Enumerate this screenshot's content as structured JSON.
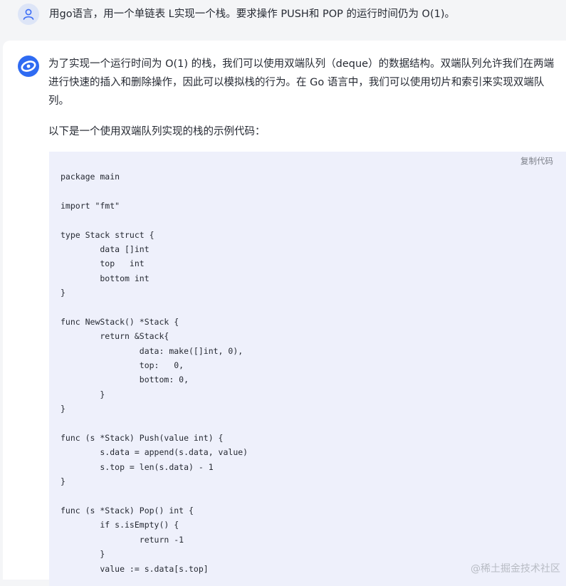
{
  "user_message": {
    "avatar_icon": "user-icon",
    "text": "用go语言，用一个单链表 L实现一个栈。要求操作 PUSH和 POP 的运行时间仍为 O(1)。"
  },
  "assistant_message": {
    "avatar_icon": "assistant-logo-icon",
    "paragraph": "为了实现一个运行时间为 O(1) 的栈，我们可以使用双端队列（deque）的数据结构。双端队列允许我们在两端进行快速的插入和删除操作，因此可以模拟栈的行为。在 Go 语言中，我们可以使用切片和索引来实现双端队列。",
    "intro": "以下是一个使用双端队列实现的栈的示例代码：",
    "code_block": {
      "copy_label": "复制代码",
      "lines": [
        "package main",
        "",
        "import \"fmt\"",
        "",
        "type Stack struct {",
        "        data []int",
        "        top   int",
        "        bottom int",
        "}",
        "",
        "func NewStack() *Stack {",
        "        return &Stack{",
        "                data: make([]int, 0),",
        "                top:   0,",
        "                bottom: 0,",
        "        }",
        "}",
        "",
        "func (s *Stack) Push(value int) {",
        "        s.data = append(s.data, value)",
        "        s.top = len(s.data) - 1",
        "}",
        "",
        "func (s *Stack) Pop() int {",
        "        if s.isEmpty() {",
        "                return -1",
        "        }",
        "        value := s.data[s.top]"
      ]
    }
  },
  "watermark": "@稀土掘金技术社区",
  "colors": {
    "page_background": "#f4f5f7",
    "panel_background": "#ffffff",
    "code_background": "#eef0fb",
    "accent_blue": "#3b6cf6"
  }
}
